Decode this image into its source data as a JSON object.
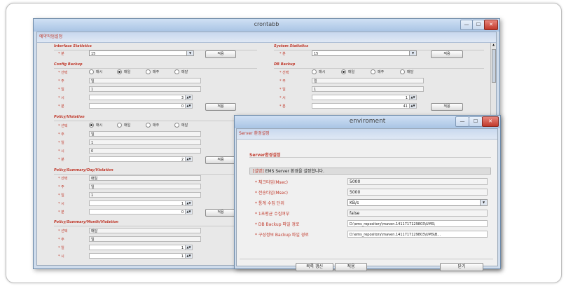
{
  "crontab": {
    "title": "crontabb",
    "header": "예약작업설정",
    "interface_statistics": {
      "title": "Interface Statistics",
      "minute_label": "* 분",
      "minute_value": "15",
      "apply": "적용"
    },
    "system_statistics": {
      "title": "System Statistics",
      "minute_label": "* 분",
      "minute_value": "15",
      "apply": "적용"
    },
    "config_backup": {
      "title": "Config Backup",
      "select_label": "* 선택",
      "options": [
        "매시",
        "매일",
        "매주",
        "매달"
      ],
      "week_label": "* 주",
      "week_value": "일",
      "day_label": "* 일",
      "day_value": "1",
      "hour_label": "* 시",
      "hour_value": "3",
      "minute_label": "* 분",
      "minute_value": "0",
      "apply": "적용"
    },
    "db_backup": {
      "title": "DB Backup",
      "select_label": "* 선택",
      "options": [
        "매시",
        "매일",
        "매주",
        "매달"
      ],
      "week_label": "* 주",
      "week_value": "일",
      "day_label": "* 일",
      "day_value": "1",
      "hour_label": "* 시",
      "hour_value": "1",
      "minute_label": "* 분",
      "minute_value": "41",
      "apply": "적용"
    },
    "policy_violation": {
      "title": "Policy/Violation",
      "select_label": "* 선택",
      "options": [
        "매시",
        "매일",
        "매주",
        "매달"
      ],
      "week_label": "* 주",
      "week_value": "일",
      "day_label": "* 일",
      "day_value": "1",
      "hour_label": "* 시",
      "hour_value": "0",
      "minute_label": "* 분",
      "minute_value": "2",
      "apply": "적용"
    },
    "policy_summary_day": {
      "title": "Policy/Summary/Day/Violation",
      "select_label": "* 선택",
      "select_value": "매일",
      "week_label": "* 주",
      "week_value": "일",
      "day_label": "* 일",
      "day_value": "1",
      "hour_label": "* 시",
      "hour_value": "1",
      "minute_label": "* 분",
      "minute_value": "0",
      "apply": "적용"
    },
    "policy_summary_month": {
      "title": "Policy/Summary/Month/Violation",
      "select_label": "* 선택",
      "select_value": "매달",
      "week_label": "* 주",
      "week_value": "일",
      "day_label": "* 일",
      "day_value": "1",
      "hour_label": "* 시",
      "hour_value": "1"
    }
  },
  "enviroment": {
    "title": "enviroment",
    "header": "Server 환경설정",
    "section": "Server환경설정",
    "info_prefix": "[설명]",
    "info_text": " EMS Server 환경을 설정합니다.",
    "rows": [
      {
        "label": "* 체크타임(Msec)",
        "value": "5000"
      },
      {
        "label": "* 전송타임(Msec)",
        "value": "5000"
      },
      {
        "label": "* 통계 수집 단위",
        "value": "KB/s"
      },
      {
        "label": "* 1초평균 수집여부",
        "value": "false"
      },
      {
        "label": "* DB Backup 파일 경로",
        "value": "D:\\ems_repository\\maven.1411717129803\\UMS\\"
      },
      {
        "label": "* 구성정보 Backup 파일 경로",
        "value": "D:\\ems_repository\\maven.1411717129803\\UMS\\B..."
      }
    ],
    "buttons": {
      "refresh": "목록 갱신",
      "apply": "적용",
      "close": "닫기"
    }
  }
}
